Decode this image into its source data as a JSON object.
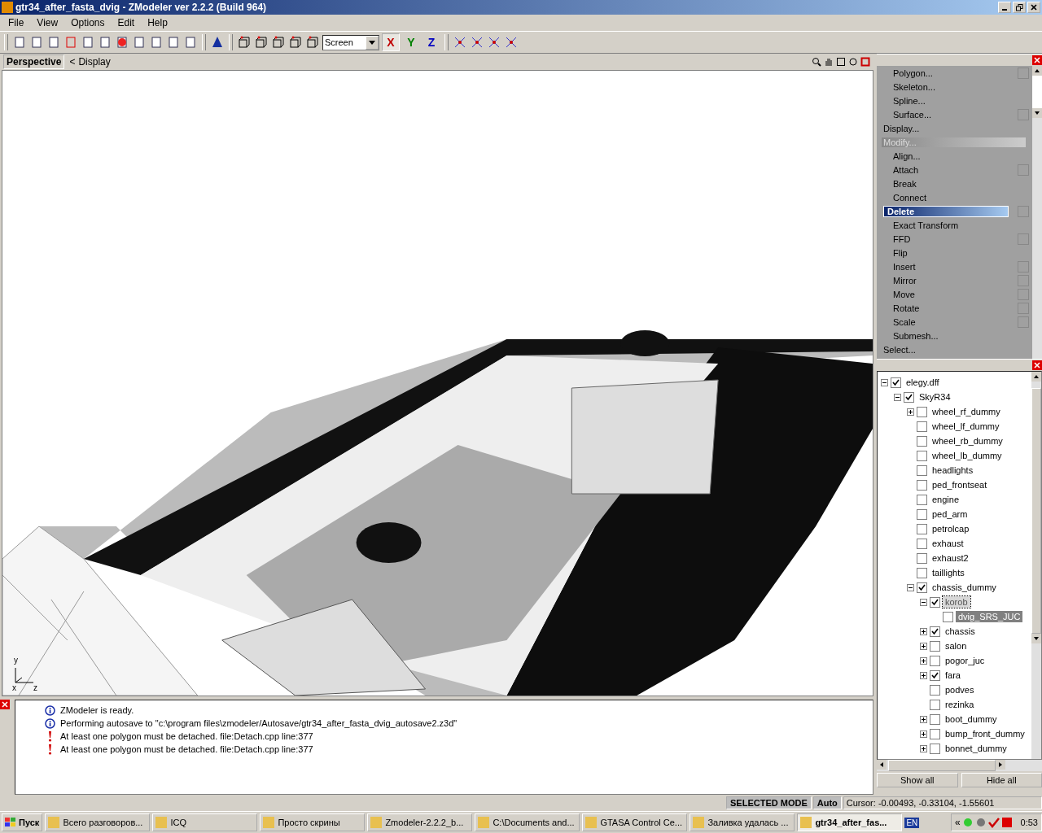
{
  "window": {
    "title": "gtr34_after_fasta_dvig - ZModeler ver 2.2.2 (Build 964)"
  },
  "menu": [
    "File",
    "View",
    "Options",
    "Edit",
    "Help"
  ],
  "toolbar": {
    "space_select": "Screen",
    "axes": [
      {
        "label": "X",
        "color": "#c00000",
        "selected": true
      },
      {
        "label": "Y",
        "color": "#008000",
        "selected": false
      },
      {
        "label": "Z",
        "color": "#0000c0",
        "selected": false
      }
    ]
  },
  "viewport": {
    "tab": "Perspective",
    "back": "<",
    "display": "Display",
    "axis_labels": [
      "x",
      "y",
      "z"
    ]
  },
  "commands": [
    {
      "kind": "command",
      "label": "Polygon...",
      "toggle": true,
      "selected": false
    },
    {
      "kind": "command",
      "label": "Skeleton...",
      "toggle": false,
      "selected": false
    },
    {
      "kind": "command",
      "label": "Spline...",
      "toggle": false,
      "selected": false
    },
    {
      "kind": "command",
      "label": "Surface...",
      "toggle": true,
      "selected": false
    },
    {
      "kind": "group",
      "label": "Display...",
      "selected": false
    },
    {
      "kind": "group",
      "label": "Modify...",
      "selected": true
    },
    {
      "kind": "command",
      "label": "Align...",
      "toggle": false,
      "selected": false
    },
    {
      "kind": "command",
      "label": "Attach",
      "toggle": true,
      "selected": false
    },
    {
      "kind": "command",
      "label": "Break",
      "toggle": false,
      "selected": false
    },
    {
      "kind": "command",
      "label": "Connect",
      "toggle": false,
      "selected": false
    },
    {
      "kind": "command",
      "label": "Delete",
      "toggle": true,
      "selected": true
    },
    {
      "kind": "command",
      "label": "Exact Transform",
      "toggle": false,
      "selected": false
    },
    {
      "kind": "command",
      "label": "FFD",
      "toggle": true,
      "selected": false
    },
    {
      "kind": "command",
      "label": "Flip",
      "toggle": false,
      "selected": false
    },
    {
      "kind": "command",
      "label": "Insert",
      "toggle": true,
      "selected": false
    },
    {
      "kind": "command",
      "label": "Mirror",
      "toggle": true,
      "selected": false
    },
    {
      "kind": "command",
      "label": "Move",
      "toggle": true,
      "selected": false
    },
    {
      "kind": "command",
      "label": "Rotate",
      "toggle": true,
      "selected": false
    },
    {
      "kind": "command",
      "label": "Scale",
      "toggle": true,
      "selected": false
    },
    {
      "kind": "command",
      "label": "Submesh...",
      "toggle": false,
      "selected": false
    },
    {
      "kind": "group",
      "label": "Select...",
      "selected": false
    }
  ],
  "tree": [
    {
      "label": "elegy.dff",
      "checked": true,
      "expanded": true,
      "selected": false,
      "focused": false,
      "children": [
        {
          "label": "SkyR34",
          "checked": true,
          "expanded": true,
          "selected": false,
          "focused": false,
          "children": [
            {
              "label": "wheel_rf_dummy",
              "checked": false,
              "expanded": false,
              "selected": false,
              "focused": false
            },
            {
              "label": "wheel_lf_dummy",
              "checked": false,
              "selected": false,
              "focused": false
            },
            {
              "label": "wheel_rb_dummy",
              "checked": false,
              "selected": false,
              "focused": false
            },
            {
              "label": "wheel_lb_dummy",
              "checked": false,
              "selected": false,
              "focused": false
            },
            {
              "label": "headlights",
              "checked": false,
              "selected": false,
              "focused": false
            },
            {
              "label": "ped_frontseat",
              "checked": false,
              "selected": false,
              "focused": false
            },
            {
              "label": "engine",
              "checked": false,
              "selected": false,
              "focused": false
            },
            {
              "label": "ped_arm",
              "checked": false,
              "selected": false,
              "focused": false
            },
            {
              "label": "petrolcap",
              "checked": false,
              "selected": false,
              "focused": false
            },
            {
              "label": "exhaust",
              "checked": false,
              "selected": false,
              "focused": false
            },
            {
              "label": "exhaust2",
              "checked": false,
              "selected": false,
              "focused": false
            },
            {
              "label": "taillights",
              "checked": false,
              "selected": false,
              "focused": false
            },
            {
              "label": "chassis_dummy",
              "checked": true,
              "expanded": true,
              "selected": false,
              "focused": false,
              "children": [
                {
                  "label": "korob",
                  "checked": true,
                  "expanded": true,
                  "selected": false,
                  "focused": true,
                  "children": [
                    {
                      "label": "dvig_SRS_JUC",
                      "checked": false,
                      "selected": true,
                      "focused": false
                    }
                  ]
                },
                {
                  "label": "chassis",
                  "checked": true,
                  "expanded": false,
                  "selected": false,
                  "focused": false
                },
                {
                  "label": "salon",
                  "checked": false,
                  "expanded": false,
                  "selected": false,
                  "focused": false
                },
                {
                  "label": "pogor_juc",
                  "checked": false,
                  "expanded": false,
                  "selected": false,
                  "focused": false
                },
                {
                  "label": "fara",
                  "checked": true,
                  "expanded": false,
                  "selected": false,
                  "focused": false
                },
                {
                  "label": "podves",
                  "checked": false,
                  "selected": false,
                  "focused": false
                },
                {
                  "label": "rezinka",
                  "checked": false,
                  "selected": false,
                  "focused": false
                },
                {
                  "label": "boot_dummy",
                  "checked": false,
                  "expanded": false,
                  "selected": false,
                  "focused": false
                },
                {
                  "label": "bump_front_dummy",
                  "checked": false,
                  "expanded": false,
                  "selected": false,
                  "focused": false
                },
                {
                  "label": "bonnet_dummy",
                  "checked": false,
                  "expanded": false,
                  "selected": false,
                  "focused": false
                }
              ]
            }
          ]
        }
      ]
    }
  ],
  "tree_buttons": [
    "Show all",
    "Hide all"
  ],
  "log": [
    {
      "kind": "info",
      "text": "ZModeler is ready."
    },
    {
      "kind": "info",
      "text": "Performing autosave to \"c:\\program files\\zmodeler/Autosave/gtr34_after_fasta_dvig_autosave2.z3d\""
    },
    {
      "kind": "error",
      "text": "At least one polygon must be detached. file:Detach.cpp line:377"
    },
    {
      "kind": "error",
      "text": "At least one polygon must be detached. file:Detach.cpp line:377"
    }
  ],
  "status_bar": {
    "mode": "SELECTED MODE",
    "snap": "Auto",
    "cursor": "Cursor: -0.00493, -0.33104, -1.55601"
  },
  "taskbar": {
    "start": "Пуск",
    "tasks": [
      {
        "label": "Всего разговоров...",
        "selected": false
      },
      {
        "label": "ICQ",
        "selected": false
      },
      {
        "label": "Просто скрины",
        "selected": false
      },
      {
        "label": "Zmodeler-2.2.2_b...",
        "selected": false
      },
      {
        "label": "C:\\Documents and...",
        "selected": false
      },
      {
        "label": "GTASA Control Ce...",
        "selected": false
      },
      {
        "label": "Заливка удалась ...",
        "selected": false
      },
      {
        "label": "gtr34_after_fas...",
        "selected": true
      }
    ],
    "language": "EN",
    "tray_expand": "«",
    "clock": "0:53"
  }
}
